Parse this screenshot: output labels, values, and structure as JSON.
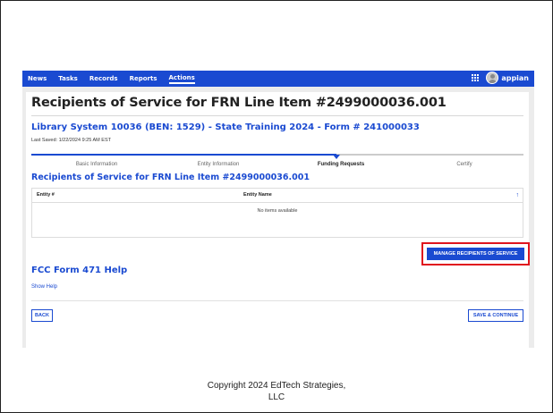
{
  "nav": {
    "items": [
      {
        "label": "News"
      },
      {
        "label": "Tasks"
      },
      {
        "label": "Records"
      },
      {
        "label": "Reports"
      },
      {
        "label": "Actions"
      }
    ],
    "active": "Actions",
    "brand": "appian"
  },
  "page": {
    "title": "Recipients of Service for FRN Line Item #2499000036.001",
    "subtitle": "Library System 10036 (BEN: 1529) - State Training 2024 - Form # 241000033",
    "last_saved": "Last Saved: 1/22/2024 9:25 AM EST"
  },
  "stepper": {
    "steps": [
      {
        "label": "Basic Information"
      },
      {
        "label": "Entity Information"
      },
      {
        "label": "Funding Requests"
      },
      {
        "label": "Certify"
      }
    ],
    "current_step": 3,
    "progress": 0.62
  },
  "section": {
    "title": "Recipients of Service for FRN Line Item #2499000036.001"
  },
  "table": {
    "columns": [
      "Entity #",
      "Entity Name"
    ],
    "sort_icon": "up-arrow-icon",
    "empty_text": "No items available"
  },
  "actions": {
    "manage_label": "MANAGE RECIPIENTS OF SERVICE",
    "back_label": "BACK",
    "save_label": "SAVE & CONTINUE"
  },
  "help": {
    "title": "FCC Form 471 Help",
    "show_label": "Show Help"
  },
  "footer": {
    "line1": "Copyright 2024 EdTech Strategies,",
    "line2": "LLC"
  },
  "colors": {
    "brand_blue": "#1a4ad1",
    "highlight_red": "#e0141e"
  }
}
